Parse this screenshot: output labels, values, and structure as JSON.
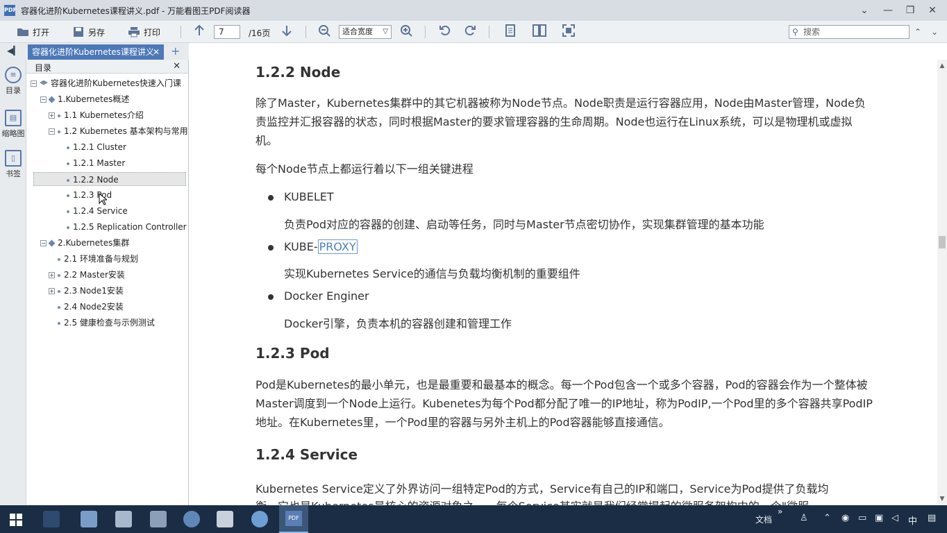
{
  "window": {
    "title": "容器化进阶Kubernetes课程讲义.pdf - 万能看图王PDF阅读器",
    "app_icon_text": "PDF",
    "controls": {
      "dropdown": "⌄",
      "minimize": "—",
      "maximize": "❐",
      "close": "✕"
    }
  },
  "toolbar": {
    "open_label": "打开",
    "saveas_label": "另存",
    "print_label": "打印",
    "page_current": "7",
    "page_total": "/16页",
    "zoom_mode": "适合宽度",
    "search_placeholder": "搜索",
    "search_prev": "⌃",
    "search_next": "⌄"
  },
  "tabs": {
    "doc_tab": "容器化进阶Kubernetes课程讲义",
    "close": "✕",
    "add": "+"
  },
  "left_strip": {
    "toc_label": "目录",
    "thumb_label": "缩略图",
    "bookmark_label": "书签"
  },
  "toc": {
    "header": "目录",
    "close": "✕",
    "items": [
      {
        "label": "容器化进阶Kubernetes快速入门课"
      },
      {
        "label": "1.Kubernetes概述"
      },
      {
        "label": "1.1 Kubernetes介绍"
      },
      {
        "label": "1.2 Kubernetes 基本架构与常用"
      },
      {
        "label": "1.2.1 Cluster"
      },
      {
        "label": "1.2.1 Master"
      },
      {
        "label": "1.2.2 Node"
      },
      {
        "label": "1.2.3 Pod"
      },
      {
        "label": "1.2.4 Service"
      },
      {
        "label": "1.2.5 Replication Controller"
      },
      {
        "label": "2.Kubernetes集群"
      },
      {
        "label": "2.1 环境准备与规划"
      },
      {
        "label": "2.2 Master安装"
      },
      {
        "label": "2.3 Node1安装"
      },
      {
        "label": "2.4 Node2安装"
      },
      {
        "label": "2.5 健康检查与示例测试"
      }
    ]
  },
  "content": {
    "node_heading": "1.2.2 Node",
    "node_para": "除了Master，Kubernetes集群中的其它机器被称为Node节点。Node职责是运行容器应用，Node由Master管理，Node负责监控并汇报容器的状态，同时根据Master的要求管理容器的生命周期。Node也运行在Linux系统，可以是物理机或虚拟机。",
    "node_intro": "每个Node节点上都运行着以下一组关键进程",
    "kubelet_title": "KUBELET",
    "kubelet_desc": "负责Pod对应的容器的创建、启动等任务，同时与Master节点密切协作，实现集群管理的基本功能",
    "proxy_title_a": "KUBE-",
    "proxy_title_b": "PROXY",
    "proxy_desc": "实现Kubernetes Service的通信与负载均衡机制的重要组件",
    "docker_title": "Docker Enginer",
    "docker_desc": "Docker引擎，负责本机的容器创建和管理工作",
    "pod_heading": "1.2.3 Pod",
    "pod_para": "Pod是Kubernetes的最小单元，也是最重要和最基本的概念。每一个Pod包含一个或多个容器，Pod的容器会作为一个整体被Master调度到一个Node上运行。Kubenetes为每个Pod都分配了唯一的IP地址，称为PodIP,一个Pod里的多个容器共享PodIP地址。在Kubernetes里，一个Pod里的容器与另外主机上的Pod容器能够直接通信。",
    "service_heading": "1.2.4 Service",
    "service_para_line1": "Kubernetes Service定义了外界访问一组特定Pod的方式，Service有自己的IP和端口，Service为Pod提供了负载均",
    "service_para_line2": "衡。它也是Kubernetes最核心的资源对象之一，每个Service其实就是我们经常提起的微服务架构中的一个\"微服"
  },
  "taskbar": {
    "doc_label": "文档",
    "chevron": "»",
    "ime": "中",
    "pdf_label": "PDF"
  },
  "colors": {
    "accent": "#4d78b8",
    "taskbar": "#1a2d45",
    "highlight": "#6a9ad8"
  }
}
